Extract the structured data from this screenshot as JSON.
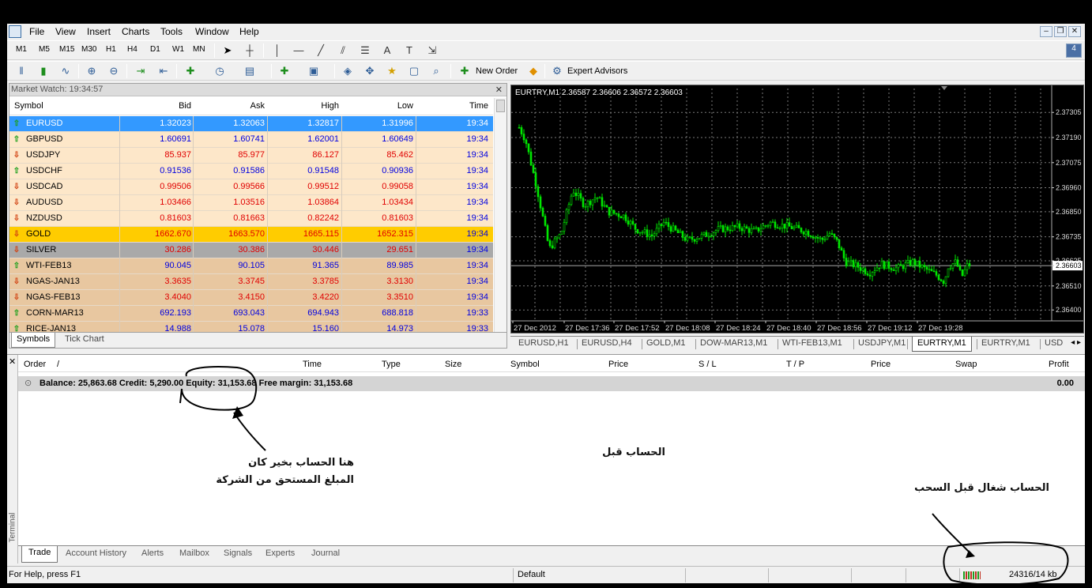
{
  "menu": [
    "File",
    "View",
    "Insert",
    "Charts",
    "Tools",
    "Window",
    "Help"
  ],
  "timeframes": [
    "M1",
    "M5",
    "M15",
    "M30",
    "H1",
    "H4",
    "D1",
    "W1",
    "MN"
  ],
  "toolbar": {
    "new_order": "New Order",
    "expert_advisors": "Expert Advisors"
  },
  "market_watch": {
    "title": "Market Watch: 19:34:57",
    "headers": [
      "Symbol",
      "Bid",
      "Ask",
      "High",
      "Low",
      "Time"
    ],
    "rows": [
      {
        "symbol": "EURUSD",
        "bid": "1.32023",
        "ask": "1.32063",
        "high": "1.32817",
        "low": "1.31996",
        "time": "19:34",
        "dir": "up",
        "style": "selected"
      },
      {
        "symbol": "GBPUSD",
        "bid": "1.60691",
        "ask": "1.60741",
        "high": "1.62001",
        "low": "1.60649",
        "time": "19:34",
        "dir": "up",
        "style": "cream-blue"
      },
      {
        "symbol": "USDJPY",
        "bid": "85.937",
        "ask": "85.977",
        "high": "86.127",
        "low": "85.462",
        "time": "19:34",
        "dir": "down",
        "style": "cream-red"
      },
      {
        "symbol": "USDCHF",
        "bid": "0.91536",
        "ask": "0.91586",
        "high": "0.91548",
        "low": "0.90936",
        "time": "19:34",
        "dir": "up",
        "style": "cream-blue"
      },
      {
        "symbol": "USDCAD",
        "bid": "0.99506",
        "ask": "0.99566",
        "high": "0.99512",
        "low": "0.99058",
        "time": "19:34",
        "dir": "down",
        "style": "cream-red"
      },
      {
        "symbol": "AUDUSD",
        "bid": "1.03466",
        "ask": "1.03516",
        "high": "1.03864",
        "low": "1.03434",
        "time": "19:34",
        "dir": "down",
        "style": "cream-red"
      },
      {
        "symbol": "NZDUSD",
        "bid": "0.81603",
        "ask": "0.81663",
        "high": "0.82242",
        "low": "0.81603",
        "time": "19:34",
        "dir": "down",
        "style": "cream-red"
      },
      {
        "symbol": "GOLD",
        "bid": "1662.670",
        "ask": "1663.570",
        "high": "1665.115",
        "low": "1652.315",
        "time": "19:34",
        "dir": "down",
        "style": "gold"
      },
      {
        "symbol": "SILVER",
        "bid": "30.286",
        "ask": "30.386",
        "high": "30.446",
        "low": "29.651",
        "time": "19:34",
        "dir": "down",
        "style": "silver"
      },
      {
        "symbol": "WTI-FEB13",
        "bid": "90.045",
        "ask": "90.105",
        "high": "91.365",
        "low": "89.985",
        "time": "19:34",
        "dir": "up",
        "style": "tan-blue"
      },
      {
        "symbol": "NGAS-JAN13",
        "bid": "3.3635",
        "ask": "3.3745",
        "high": "3.3785",
        "low": "3.3130",
        "time": "19:34",
        "dir": "down",
        "style": "tan-red"
      },
      {
        "symbol": "NGAS-FEB13",
        "bid": "3.4040",
        "ask": "3.4150",
        "high": "3.4220",
        "low": "3.3510",
        "time": "19:34",
        "dir": "down",
        "style": "tan-red"
      },
      {
        "symbol": "CORN-MAR13",
        "bid": "692.193",
        "ask": "693.043",
        "high": "694.943",
        "low": "688.818",
        "time": "19:33",
        "dir": "up",
        "style": "tan-blue"
      },
      {
        "symbol": "RICE-JAN13",
        "bid": "14.988",
        "ask": "15.078",
        "high": "15.160",
        "low": "14.973",
        "time": "19:33",
        "dir": "up",
        "style": "tan-blue"
      }
    ],
    "tabs": [
      "Symbols",
      "Tick Chart"
    ]
  },
  "chart": {
    "title": "EURTRY,M1  2.36587 2.36606 2.36572 2.36603",
    "price_labels": [
      "2.37305",
      "2.37190",
      "2.37075",
      "2.36960",
      "2.36850",
      "2.36735",
      "2.36625",
      "2.36603",
      "2.36510",
      "2.36400"
    ],
    "current_price": "2.36603",
    "time_labels": [
      "27 Dec 2012",
      "27 Dec 17:36",
      "27 Dec 17:52",
      "27 Dec 18:08",
      "27 Dec 18:24",
      "27 Dec 18:40",
      "27 Dec 18:56",
      "27 Dec 19:12",
      "27 Dec 19:28"
    ],
    "tabs": [
      "EURUSD,H1",
      "EURUSD,H4",
      "GOLD,M1",
      "DOW-MAR13,M1",
      "WTI-FEB13,M1",
      "USDJPY,M1",
      "EURTRY,M1",
      "EURTRY,M1",
      "USD"
    ],
    "active_tab": 6,
    "colors": {
      "candle": "#00e600",
      "background": "#000000",
      "grid": "#7a7a7a"
    }
  },
  "terminal": {
    "side_label": "Terminal",
    "headers": [
      "Order",
      "/",
      "Time",
      "Type",
      "Size",
      "Symbol",
      "Price",
      "S / L",
      "T / P",
      "Price",
      "Swap",
      "Profit"
    ],
    "balance_line": "Balance: 25,863.68  Credit: 5,290.00  Equity: 31,153.68  Free margin: 31,153.68",
    "profit_total": "0.00",
    "tabs": [
      "Trade",
      "Account History",
      "Alerts",
      "Mailbox",
      "Signals",
      "Experts",
      "Journal"
    ]
  },
  "status": {
    "help": "For Help, press F1",
    "profile": "Default",
    "traffic": "24316/14 kb"
  },
  "annotations": {
    "note1_line1": "هنا الحساب بخير كان",
    "note1_line2": "المبلغ المستحق من الشركة",
    "note2": "الحساب قبل",
    "note3": "الحساب شغال قبل السحب"
  }
}
